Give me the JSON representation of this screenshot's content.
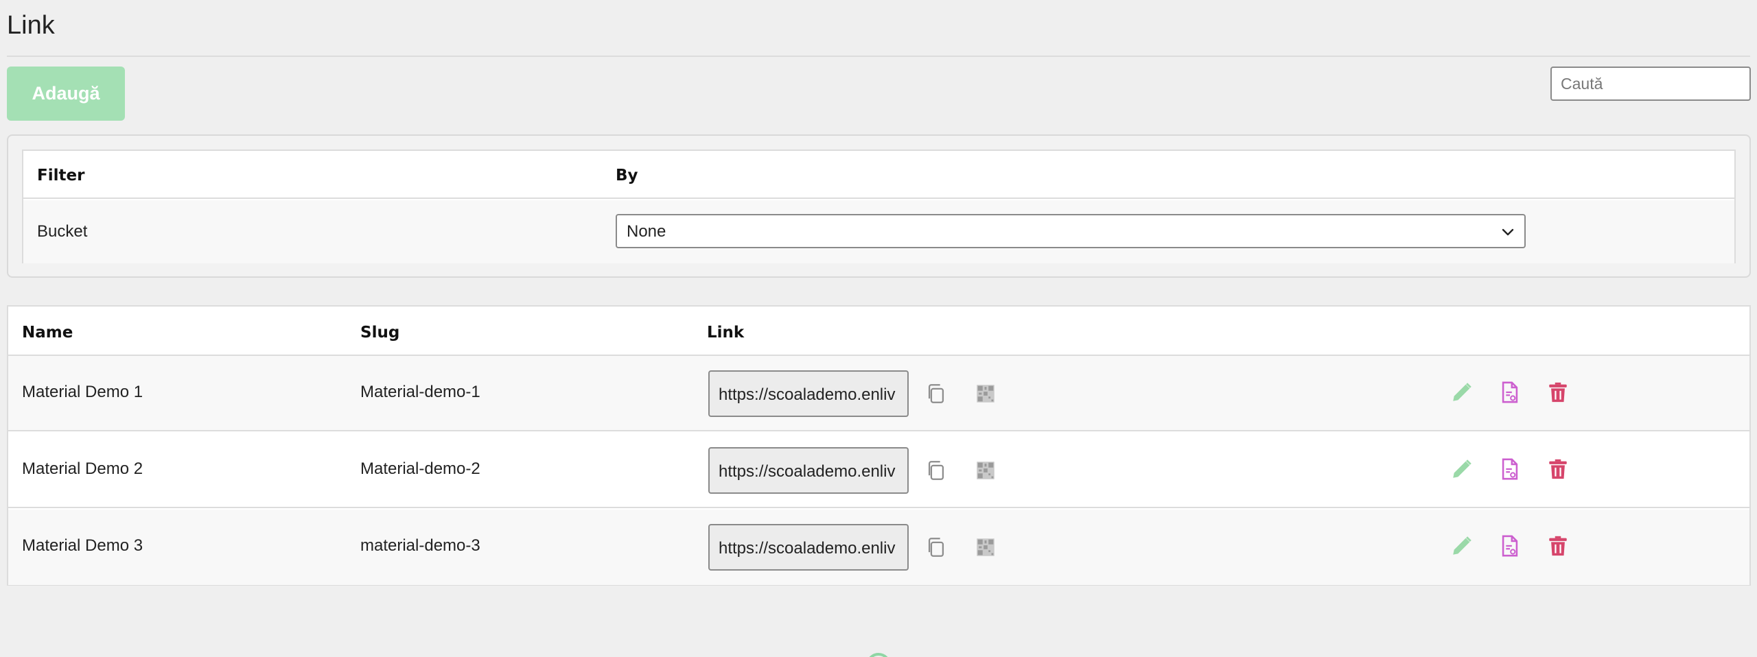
{
  "header": {
    "title": "Link",
    "add_label": "Adaugă",
    "search_placeholder": "Caută"
  },
  "filter": {
    "columns": [
      "Filter",
      "By"
    ],
    "rows": [
      {
        "filter": "Bucket",
        "by": "None"
      }
    ]
  },
  "table": {
    "columns": [
      "Name",
      "Slug",
      "Link"
    ],
    "rows": [
      {
        "name": "Material Demo 1",
        "slug": "Material-demo-1",
        "link": "https://scoalademo.enliv"
      },
      {
        "name": "Material Demo 2",
        "slug": "Material-demo-2",
        "link": "https://scoalademo.enliv"
      },
      {
        "name": "Material Demo 3",
        "slug": "material-demo-3",
        "link": "https://scoalademo.enliv"
      }
    ]
  },
  "icons": {
    "copy": "copy-icon",
    "qr": "qr-code-icon",
    "edit": "pencil-icon",
    "report": "document-chart-icon",
    "delete": "trash-icon"
  },
  "colors": {
    "add_button": "#a4e0b4",
    "edit_icon": "#9ad9a8",
    "report_icon": "#cc5fcf",
    "delete_icon": "#d6456b",
    "page_bg": "#efefef"
  }
}
